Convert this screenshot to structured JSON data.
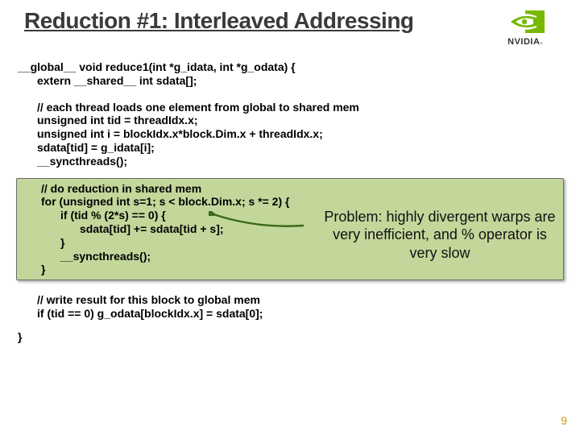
{
  "title": "Reduction #1: Interleaved Addressing",
  "logo": {
    "brand": "NVIDIA",
    "reg": "®"
  },
  "code": {
    "sig_open": "__global__ void reduce1(int *g_idata, int *g_odata) {",
    "shared_decl": "extern __shared__ int sdata[];",
    "load_comment": "// each thread loads one element from global to shared mem",
    "tid": "unsigned int tid = threadIdx.x;",
    "i": "unsigned int i = blockIdx.x*block.Dim.x + threadIdx.x;",
    "assign": "sdata[tid] = g_idata[i];",
    "sync1": "__syncthreads();",
    "red_comment": "// do reduction in shared mem",
    "for_open": "for (unsigned int s=1; s < block.Dim.x; s *= 2) {",
    "if_open": "if (tid % (2*s) == 0) {",
    "sum": "sdata[tid] += sdata[tid + s];",
    "if_close": "}",
    "sync2": "__syncthreads();",
    "for_close": "}",
    "write_comment": "// write result for this block to global mem",
    "write": "if (tid == 0) g_odata[blockIdx.x] = sdata[0];",
    "func_close": "}"
  },
  "annotation": "Problem: highly divergent warps are very inefficient, and % operator is very slow",
  "pagenum": "9"
}
